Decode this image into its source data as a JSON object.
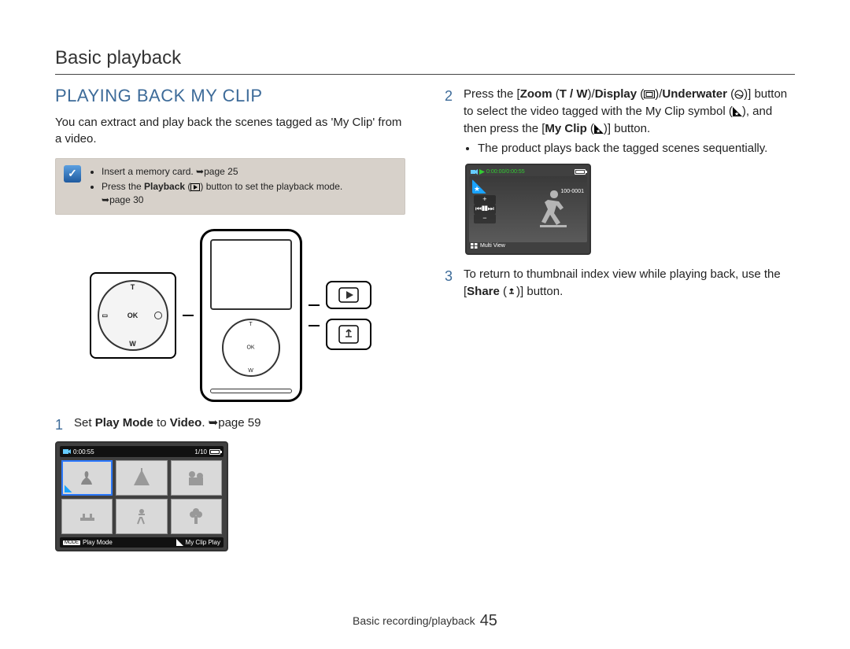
{
  "header": {
    "breadcrumb": "Basic playback"
  },
  "section": {
    "title": "PLAYING BACK MY CLIP",
    "intro": "You can extract and play back the scenes tagged as 'My Clip' from a video."
  },
  "note": {
    "icon_glyph": "✓",
    "items": [
      {
        "pre": "Insert a memory card. ",
        "ref": "page 25"
      },
      {
        "pre": "Press the ",
        "bold": "Playback",
        "post_pre": " (",
        "post": ") button to set the playback mode.",
        "ref": "page 30"
      }
    ]
  },
  "dpad": {
    "top": "T",
    "bottom": "W",
    "left": "",
    "center": "OK"
  },
  "thumb_screen": {
    "time": "0:00:55",
    "counter": "1/10",
    "left_label": "Play Mode",
    "right_label": "My Clip Play"
  },
  "play_screen": {
    "time": "0:00:00/0:00:55",
    "file": "100-0001",
    "label": "Multi View",
    "plus": "+",
    "minus": "−",
    "prev": "⏮",
    "pause": "❚❚",
    "next": "⏭"
  },
  "steps": {
    "s1": {
      "num": "1",
      "a": "Set ",
      "b1": "Play Mode",
      "b": " to ",
      "b2": "Video",
      "c": ". ",
      "ref": "page 59"
    },
    "s2": {
      "num": "2",
      "a": "Press the [",
      "b1": "Zoom",
      "sp1": " (",
      "z": "T / W",
      "sp1b": ")/",
      "b2": "Display",
      "sp2": " (",
      "sp2b": ")/",
      "b3": "Underwater",
      "sp3": " (",
      "sp3b": ")] button",
      "c": "to select the video tagged with the My Clip symbol (",
      "c2": "), and then press the [",
      "b4": "My Clip",
      "sp4": " (",
      "sp4b": ")] button.",
      "sub": "The product plays back the tagged scenes sequentially."
    },
    "s3": {
      "num": "3",
      "a": "To return to thumbnail index view while playing back, use the [",
      "b1": "Share",
      "sp": " (",
      "spb": ")] button."
    }
  },
  "footer": {
    "section": "Basic recording/playback",
    "page": "45"
  }
}
